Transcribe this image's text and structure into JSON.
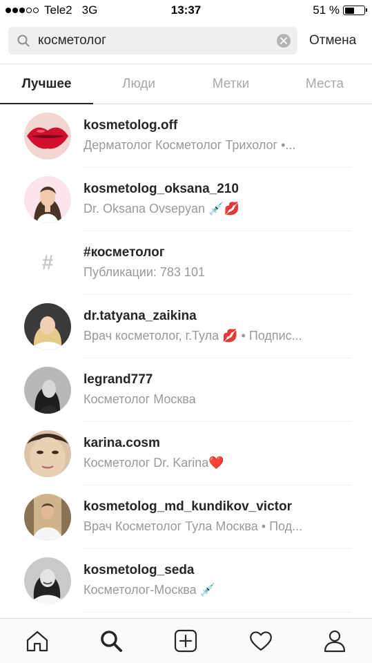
{
  "status_bar": {
    "carrier": "Tele2",
    "network": "3G",
    "time": "13:37",
    "battery": "51 %",
    "battery_level": 0.51,
    "signal_bars_filled": 3,
    "signal_bars_total": 5
  },
  "search": {
    "query": "косметолог",
    "cancel_label": "Отмена"
  },
  "tabs": [
    {
      "label": "Лучшее",
      "active": true
    },
    {
      "label": "Люди",
      "active": false
    },
    {
      "label": "Метки",
      "active": false
    },
    {
      "label": "Места",
      "active": false
    }
  ],
  "results": [
    {
      "title": "kosmetolog.off",
      "subtitle": "Дерматолог Косметолог Трихолог •...",
      "type": "user",
      "icon": "lips-avatar"
    },
    {
      "title": "kosmetolog_oksana_210",
      "subtitle": "Dr. Oksana Ovsepyan 💉💋",
      "type": "user",
      "icon": "illustrated-woman-avatar"
    },
    {
      "title": "#косметолог",
      "subtitle": "Публикации: 783 101",
      "type": "hashtag",
      "icon": "hashtag-icon",
      "icon_glyph": "#"
    },
    {
      "title": "dr.tatyana_zaikina",
      "subtitle": "Врач косметолог, г.Тула 💋 • Подпис...",
      "type": "user",
      "icon": "blonde-woman-avatar"
    },
    {
      "title": "legrand777",
      "subtitle": "Косметолог Москва",
      "type": "user",
      "icon": "bw-woman-avatar"
    },
    {
      "title": "karina.cosm",
      "subtitle": "Косметолог Dr. Karina❤️",
      "type": "user",
      "icon": "closeup-face-avatar"
    },
    {
      "title": "kosmetolog_md_kundikov_victor",
      "subtitle": "Врач Косметолог Тула Москва • Под...",
      "type": "user",
      "icon": "man-avatar"
    },
    {
      "title": "kosmetolog_seda",
      "subtitle": "Косметолог-Москва 💉",
      "type": "user",
      "icon": "bw-smiling-woman-avatar"
    }
  ],
  "bottom_nav": [
    {
      "name": "home",
      "icon": "home-icon",
      "active": false
    },
    {
      "name": "search",
      "icon": "search-icon",
      "active": true
    },
    {
      "name": "new-post",
      "icon": "plus-square-icon",
      "active": false
    },
    {
      "name": "activity",
      "icon": "heart-icon",
      "active": false
    },
    {
      "name": "profile",
      "icon": "person-icon",
      "active": false
    }
  ]
}
